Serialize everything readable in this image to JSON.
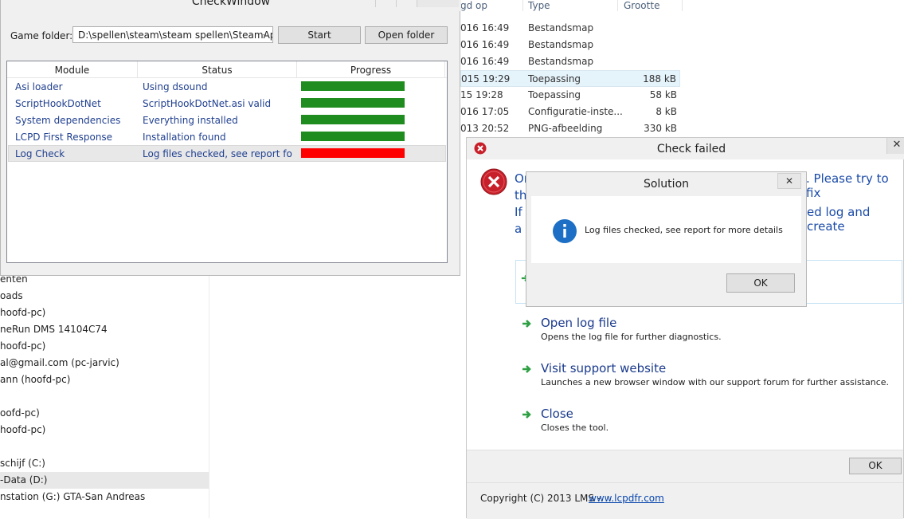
{
  "explorer": {
    "headers": [
      "gd op",
      "Type",
      "Grootte"
    ],
    "rows": [
      {
        "date": "016 16:49",
        "type": "Bestandsmap",
        "size": ""
      },
      {
        "date": "016 16:49",
        "type": "Bestandsmap",
        "size": ""
      },
      {
        "date": "016 16:49",
        "type": "Bestandsmap",
        "size": ""
      },
      {
        "date": "015 19:29",
        "type": "Toepassing",
        "size": "188 kB"
      },
      {
        "date": "15 19:28",
        "type": "Toepassing",
        "size": "58 kB"
      },
      {
        "date": "016 17:05",
        "type": "Configuratie-inste...",
        "size": "8 kB"
      },
      {
        "date": "013 20:52",
        "type": "PNG-afbeelding",
        "size": "330 kB"
      }
    ],
    "nav_items": [
      "enten",
      "oads",
      "hoofd-pc)",
      "neRun DMS 14104C74",
      "hoofd-pc)",
      "al@gmail.com (pc-jarvic)",
      "ann (hoofd-pc)",
      "",
      "oofd-pc)",
      "hoofd-pc)",
      "",
      "schijf (C:)",
      "-Data (D:)",
      "nstation (G:) GTA-San Andreas"
    ]
  },
  "checkwindow": {
    "title": "CheckWindow",
    "game_folder_label": "Game folder:",
    "game_folder_value": "D:\\spellen\\steam\\steam spellen\\SteamApp",
    "start_label": "Start",
    "open_folder_label": "Open folder",
    "columns": [
      "Module",
      "Status",
      "Progress"
    ],
    "rows": [
      {
        "module": "Asi loader",
        "status": "Using dsound",
        "progress": 1.0,
        "color": "#1e8c1e"
      },
      {
        "module": "ScriptHookDotNet",
        "status": "ScriptHookDotNet.asi valid",
        "progress": 1.0,
        "color": "#1e8c1e"
      },
      {
        "module": "System dependencies",
        "status": "Everything installed",
        "progress": 1.0,
        "color": "#1e8c1e"
      },
      {
        "module": "LCPD First Response",
        "status": "Installation found",
        "progress": 1.0,
        "color": "#1e8c1e"
      },
      {
        "module": "Log Check",
        "status": "Log files checked, see report for more details",
        "progress": 1.0,
        "color": "#ff0000"
      }
    ]
  },
  "check_failed": {
    "title": "Check failed",
    "close_glyph": "✕",
    "msg_line1_left": "Or",
    "msg_line1_right": ". Please try to fix",
    "msg_line2_left": "th",
    "msg_line3_left": "If y",
    "msg_line3_right": "ed log and create",
    "msg_line4_left": "a t",
    "commands": [
      {
        "title": "Open log file",
        "desc": "Opens the log file for further diagnostics."
      },
      {
        "title": "Visit support website",
        "desc": "Launches a new browser window with our support forum for further assistance."
      },
      {
        "title": "Close",
        "desc": "Closes the tool."
      }
    ],
    "ok_label": "OK",
    "copyright": "Copyright (C) 2013 LMS - ",
    "link": "www.lcpdfr.com",
    "colors": {
      "error_red": "#c8202a",
      "arrow_green": "#2ea043",
      "link": "#0645ad"
    }
  },
  "solution": {
    "title": "Solution",
    "close_glyph": "✕",
    "message": "Log files checked, see report for more details",
    "ok_label": "OK",
    "info_color": "#1c6fc4"
  }
}
